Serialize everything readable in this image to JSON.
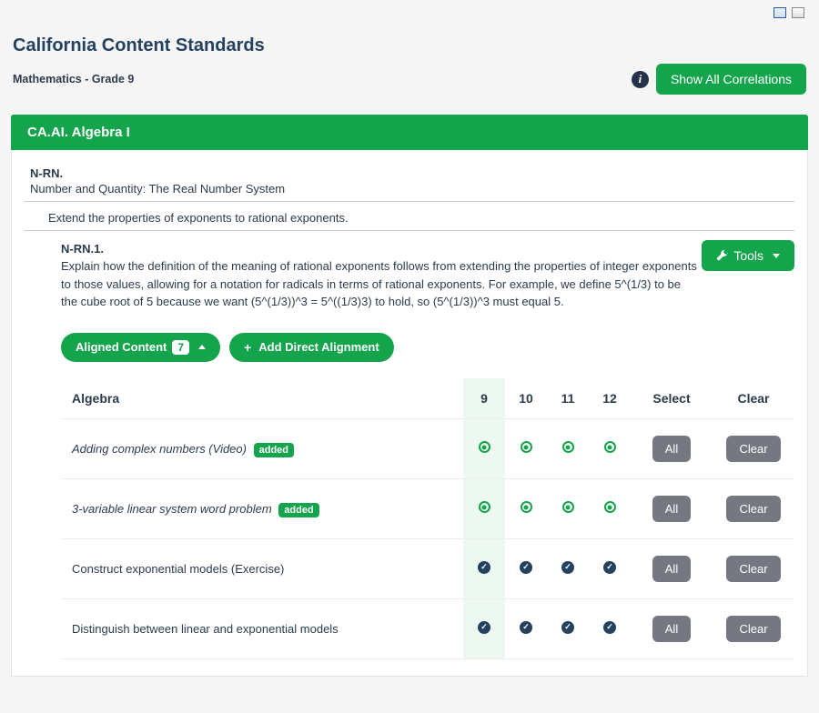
{
  "page_title": "California Content Standards",
  "grade_label": "Mathematics - Grade 9",
  "show_all_label": "Show All Correlations",
  "section_bar": "CA.AI. Algebra I",
  "standard": {
    "code": "N-RN.",
    "name": "Number and Quantity: The Real Number System",
    "subcategory": "Extend the properties of exponents to rational exponents.",
    "detail_code": "N-RN.1.",
    "detail_text": "Explain how the definition of the meaning of rational exponents follows from extending the properties of integer exponents to those values, allowing for a notation for radicals in terms of rational exponents. For example, we define 5^(1/3) to be the cube root of 5 because we want (5^(1/3))^3 = 5^((1/3)3) to hold, so (5^(1/3))^3 must equal 5."
  },
  "tools_label": "Tools",
  "aligned_pill": {
    "label": "Aligned Content",
    "count": 7
  },
  "add_direct_label": "Add Direct Alignment",
  "columns": {
    "subject": "Algebra",
    "g9": "9",
    "g10": "10",
    "g11": "11",
    "g12": "12",
    "select": "Select",
    "clear": "Clear"
  },
  "buttons": {
    "all": "All",
    "clear": "Clear"
  },
  "added_badge": "added",
  "rows": [
    {
      "title": "Adding complex numbers (Video)",
      "added": true,
      "state": "ring"
    },
    {
      "title": "3-variable linear system word problem",
      "added": true,
      "state": "ring"
    },
    {
      "title": "Construct exponential models (Exercise)",
      "added": false,
      "state": "solid"
    },
    {
      "title": "Distinguish between linear and exponential models",
      "added": false,
      "state": "solid"
    }
  ]
}
